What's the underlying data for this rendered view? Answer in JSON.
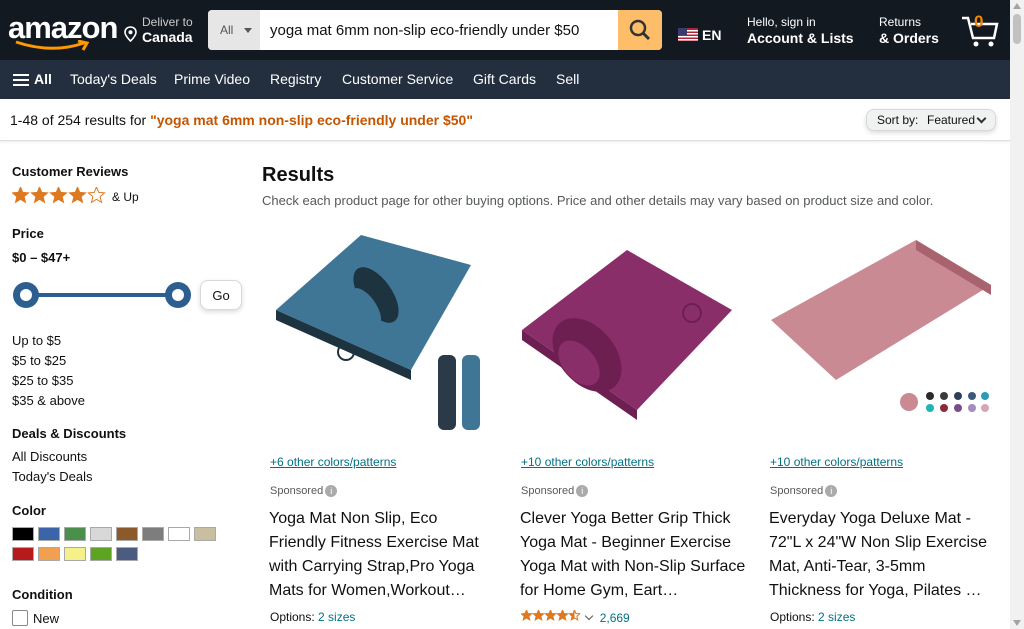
{
  "header": {
    "logo": "amazon",
    "deliver_line1": "Deliver to",
    "deliver_line2": "Canada",
    "search_category": "All",
    "search_value": "yoga mat 6mm non-slip eco-friendly under $50",
    "lang": "EN",
    "account_line1": "Hello, sign in",
    "account_line2": "Account & Lists",
    "orders_line1": "Returns",
    "orders_line2": "& Orders",
    "cart_count": "0"
  },
  "nav": {
    "all": "All",
    "items": [
      "Today's Deals",
      "Prime Video",
      "Registry",
      "Customer Service",
      "Gift Cards",
      "Sell"
    ]
  },
  "results_bar": {
    "count_text": "1-48 of 254 results for ",
    "query": "\"yoga mat 6mm non-slip eco-friendly under $50\"",
    "sort_label": "Sort by:",
    "sort_value": "Featured"
  },
  "sidebar": {
    "reviews_heading": "Customer Reviews",
    "reviews_up": "& Up",
    "reviews_stars": 4,
    "price_heading": "Price",
    "price_range": "$0 – $47+",
    "price_min_fraction": 0,
    "price_max_fraction": 1,
    "go": "Go",
    "price_links": [
      "Up to $5",
      "$5 to $25",
      "$25 to $35",
      "$35 & above"
    ],
    "deals_heading": "Deals & Discounts",
    "deals_links": [
      "All Discounts",
      "Today's Deals"
    ],
    "color_heading": "Color",
    "swatch_colors": [
      "#000000",
      "#3a65a8",
      "#4a8f4a",
      "#d8d8d8",
      "#8b5a2b",
      "#7d7d7d",
      "#ffffff",
      "#c8bfa0",
      "#b61a1a",
      "#f0a050",
      "#f5f08a",
      "#5da424",
      "#4a5d80"
    ],
    "condition_heading": "Condition",
    "condition_new": "New"
  },
  "main": {
    "heading": "Results",
    "subheading": "Check each product page for other buying options. Price and other details may vary based on product size and color.",
    "products": [
      {
        "colors_link": "+6 other colors/patterns",
        "sponsored": "Sponsored",
        "title": "Yoga Mat Non Slip, Eco Friendly Fitness Exercise Mat with Carrying Strap,Pro Yoga Mats for Women,Workout…",
        "options_label": "Options:",
        "options_link": "2 sizes",
        "mat_color": "#3f7696",
        "mat_dark": "#1e3340"
      },
      {
        "colors_link": "+10 other colors/patterns",
        "sponsored": "Sponsored",
        "title": "Clever Yoga Better Grip Thick Yoga Mat - Beginner Exercise Yoga Mat with Non-Slip Surface for Home Gym, Eart…",
        "rating_stars": 4.5,
        "rating_count": "2,669",
        "mat_color": "#8a2e6a",
        "mat_dark": "#6d1f52"
      },
      {
        "colors_link": "+10 other colors/patterns",
        "sponsored": "Sponsored",
        "title": "Everyday Yoga Deluxe Mat - 72\"L x 24\"W Non Slip Exercise Mat, Anti-Tear, 3-5mm Thickness for Yoga, Pilates …",
        "options_label": "Options:",
        "options_link": "2 sizes",
        "mat_color": "#c98a94",
        "mat_dark": "#a9636f"
      }
    ]
  }
}
